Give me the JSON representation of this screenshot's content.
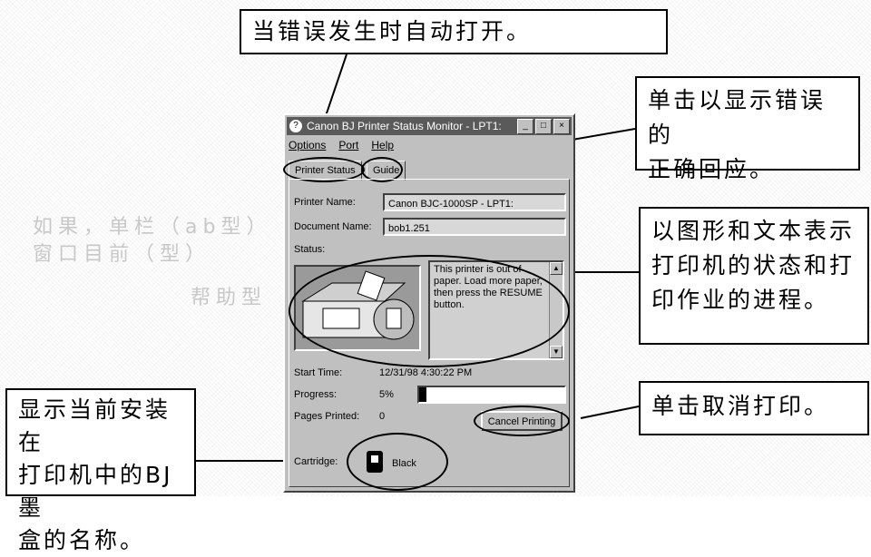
{
  "callouts": {
    "auto_open": "当错误发生时自动打开。",
    "guide": [
      "单击以显示错误的",
      "正确回应。"
    ],
    "status": [
      "以图形和文本表示",
      "打印机的状态和打",
      "印作业的进程。"
    ],
    "cancel": "单击取消打印。",
    "cartridge": [
      "显示当前安装在",
      "打印机中的BJ墨",
      "盒的名称。"
    ]
  },
  "window": {
    "title": "Canon BJ Printer Status Monitor - LPT1:",
    "title_buttons": [
      "_",
      "□",
      "×"
    ],
    "menu": [
      "Options",
      "Port",
      "Help"
    ],
    "tabs": [
      "Printer Status",
      "Guide"
    ],
    "printer_name_label": "Printer Name:",
    "printer_name_value": "Canon BJC-1000SP - LPT1:",
    "document_name_label": "Document Name:",
    "document_name_value": "bob1.251",
    "status_label": "Status:",
    "status_message": "This printer is out of paper. Load more paper, then press the RESUME button.",
    "start_time_label": "Start Time:",
    "start_time_value": "12/31/98 4:30:22 PM",
    "progress_label": "Progress:",
    "progress_value": "5%",
    "progress_fraction": 0.05,
    "pages_printed_label": "Pages Printed:",
    "pages_printed_value": "0",
    "cancel_button": "Cancel Printing",
    "cartridge_label": "Cartridge:",
    "cartridge_value": "Black"
  },
  "faded_background": [
    "如果，单栏（ab型）",
    "窗口目前（型）",
    "帮助型"
  ]
}
